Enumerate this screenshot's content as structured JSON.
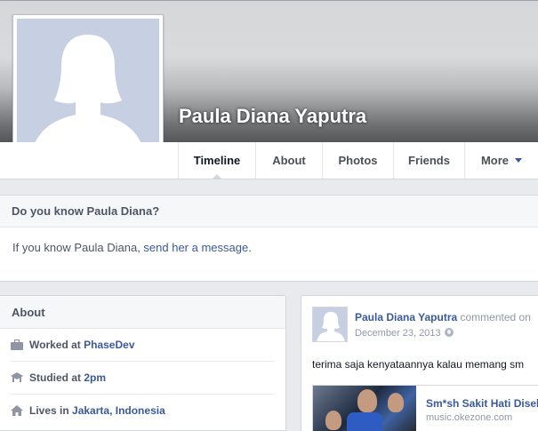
{
  "profile": {
    "name": "Paula Diana Yaputra"
  },
  "nav": {
    "tabs": [
      {
        "label": "Timeline"
      },
      {
        "label": "About"
      },
      {
        "label": "Photos"
      },
      {
        "label": "Friends"
      },
      {
        "label": "More"
      }
    ]
  },
  "know": {
    "title": "Do you know Paula Diana?",
    "prefix": "If you know Paula Diana, ",
    "link": "send her a message",
    "suffix": "."
  },
  "about": {
    "title": "About",
    "rows": [
      {
        "label": "Worked at ",
        "value": "PhaseDev",
        "icon": "briefcase-icon"
      },
      {
        "label": "Studied at ",
        "value": "2pm",
        "icon": "graduation-cap-icon"
      },
      {
        "label": "Lives in ",
        "value": "Jakarta, Indonesia",
        "icon": "home-icon"
      }
    ]
  },
  "post": {
    "author": "Paula Diana Yaputra",
    "action": " commented on",
    "date": "December 23, 2013",
    "text": "terima saja kenyataannya kalau memang sm",
    "share": {
      "title": "Sm*sh Sakit Hati Diseb",
      "domain": "music.okezone.com"
    }
  },
  "colors": {
    "link": "#3b5998",
    "muted": "#4e5665",
    "background": "#e9eaed"
  }
}
